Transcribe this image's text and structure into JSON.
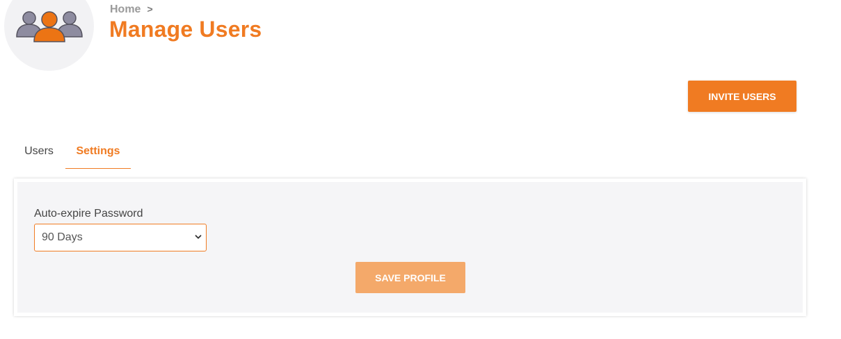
{
  "header": {
    "breadcrumb": {
      "home_label": "Home",
      "separator": ">"
    },
    "title": "Manage Users",
    "avatar_icon": "users-group-icon"
  },
  "actions": {
    "invite_label": "INVITE USERS"
  },
  "tabs": [
    {
      "label": "Users",
      "active": false
    },
    {
      "label": "Settings",
      "active": true
    }
  ],
  "settings": {
    "auto_expire": {
      "label": "Auto-expire Password",
      "selected_value": "90 Days"
    },
    "save_label": "SAVE PROFILE"
  },
  "colors": {
    "accent": "#f07b22",
    "accent_disabled": "#f4a96a",
    "panel_background": "#f5f5f7",
    "icon_gray": "#8e8ca0"
  }
}
